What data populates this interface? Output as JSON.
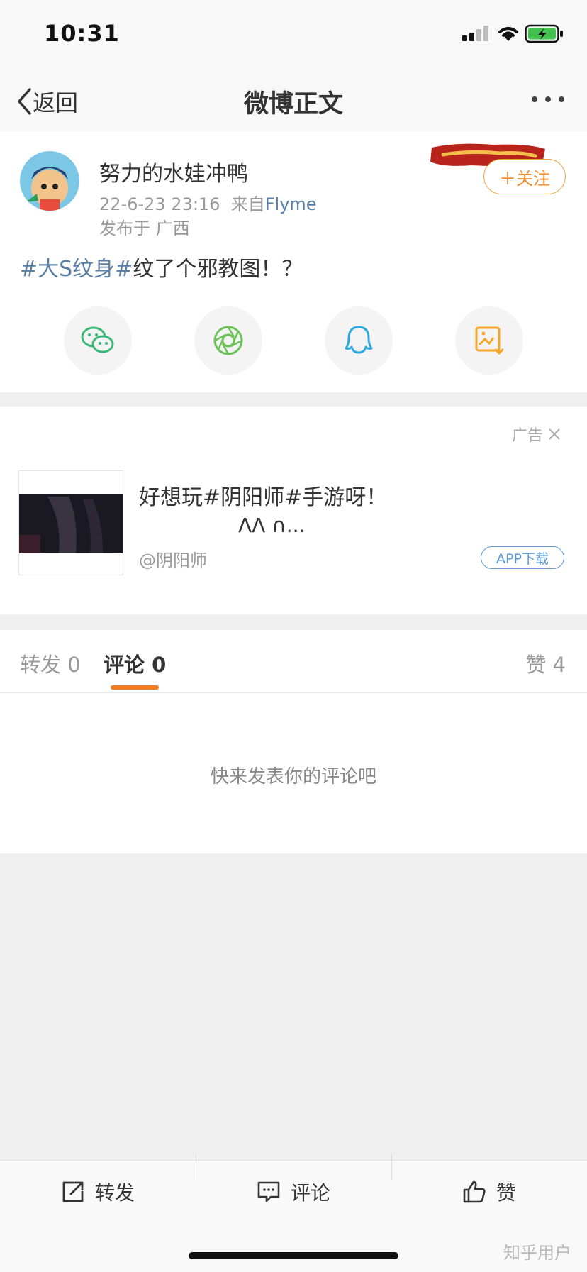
{
  "status_bar": {
    "time": "10:31"
  },
  "nav": {
    "back_label": "返回",
    "title": "微博正文"
  },
  "post": {
    "username": "努力的水娃冲鸭",
    "date": "22-6-23 23:16",
    "source_prefix": "来自",
    "source": "Flyme",
    "location": "发布于 广西",
    "follow_label": "＋关注",
    "topic": "#大S纹身#",
    "text": "纹了个邪教图！？"
  },
  "share_icons": [
    "wechat-icon",
    "moments-icon",
    "qq-icon",
    "save-image-icon"
  ],
  "ad": {
    "label": "广告",
    "title": "好想玩#阴阳师#手游呀！",
    "subtitle": "ΛΛ ∩...",
    "account": "@阴阳师",
    "download_label": "APP下载"
  },
  "tabs": {
    "repost_label": "转发",
    "repost_count": "0",
    "comment_label": "评论",
    "comment_count": "0",
    "like_label": "赞",
    "like_count": "4"
  },
  "comments": {
    "empty_text": "快来发表你的评论吧"
  },
  "toolbar": {
    "repost": "转发",
    "comment": "评论",
    "like": "赞"
  },
  "watermark": "知乎用户",
  "colors": {
    "link": "#5a7fa6",
    "accent": "#f07c24",
    "follow": "#f0a037"
  }
}
